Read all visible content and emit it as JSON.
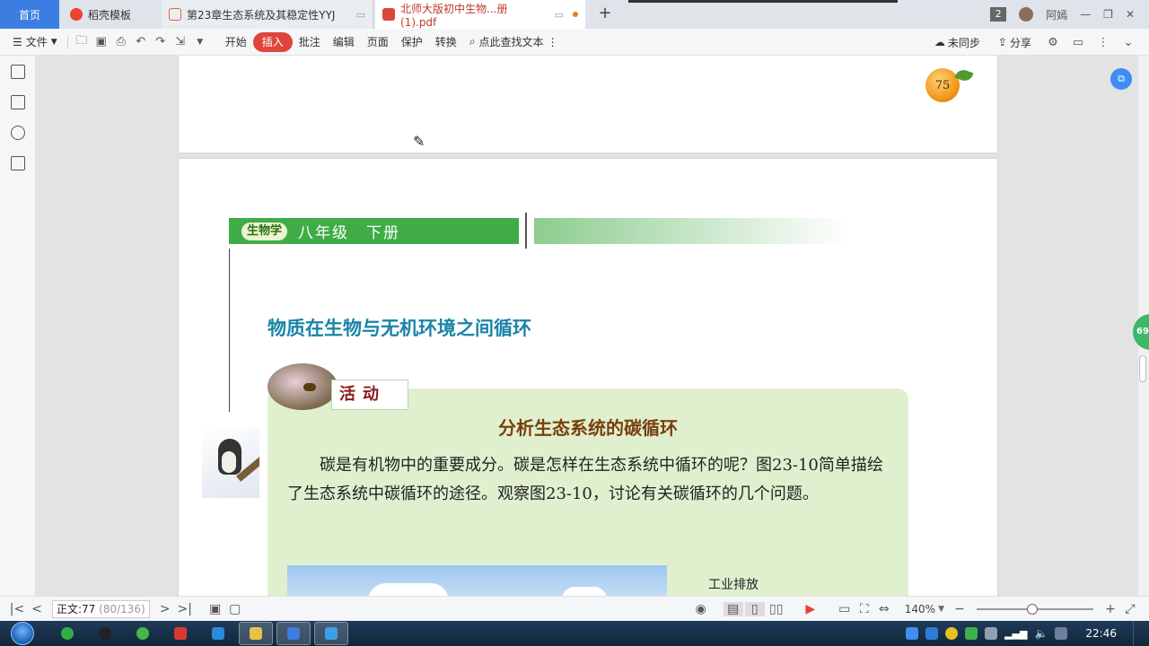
{
  "tabs": {
    "home": "首页",
    "tab1": "稻壳模板",
    "tab2": "第23章生态系统及其稳定性YYJ",
    "tab3": "北师大版初中生物...册(1).pdf",
    "new_tab": "+",
    "page_count_badge": "2",
    "user_name": "阿嫣"
  },
  "toolbar": {
    "file": "文件",
    "start": "开始",
    "insert": "插入",
    "comment": "批注",
    "edit": "编辑",
    "page": "页面",
    "protect": "保护",
    "convert": "转换",
    "search": "点此查找文本",
    "sync": "未同步",
    "share": "分享"
  },
  "document": {
    "page1": {
      "page_number": "75"
    },
    "page2": {
      "subject_logo": "生物学",
      "grade": "八年级　下册",
      "heading": "物质在生物与无机环境之间循环",
      "activity_label": "活动",
      "activity_title": "分析生态系统的碳循环",
      "activity_text": "碳是有机物中的重要成分。碳是怎样在生态系统中循环的呢？图23-10简单描绘了生态系统中碳循环的途径。观察图23-10，讨论有关碳循环的几个问题。",
      "diagram_label": "工业排放"
    }
  },
  "right_panel": {
    "bubble": "69"
  },
  "statusbar": {
    "page_label": "正文:77",
    "page_range": "(80/136)",
    "zoom": "140%",
    "zoom_fraction": 0.48
  },
  "taskbar": {
    "clock": "22:46"
  },
  "colors": {
    "accent_red": "#e0453a",
    "home_tab": "#3b7de0",
    "book_green": "#3fac48",
    "heading_blue": "#1a84a8",
    "activity_bg": "#e0f0cf"
  }
}
